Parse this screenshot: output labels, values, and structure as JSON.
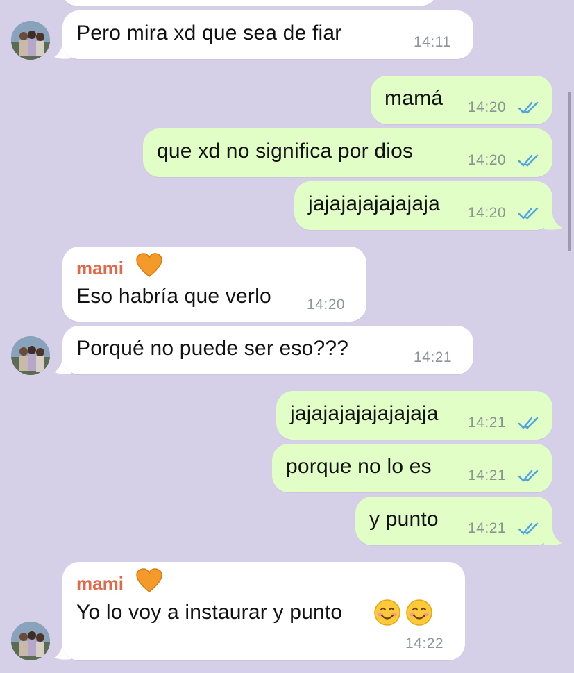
{
  "messages": [
    {
      "text": "Pero mira xd que sea de fiar",
      "time": "14:11"
    },
    {
      "text": "mamá",
      "time": "14:20",
      "status": "read"
    },
    {
      "text": "que xd no significa por dios",
      "time": "14:20",
      "status": "read"
    },
    {
      "text": "jajajajajajajaja",
      "time": "14:20",
      "status": "read"
    },
    {
      "sender": "mami",
      "text": "Eso habría que verlo",
      "time": "14:20"
    },
    {
      "text": "Porqué no puede ser eso???",
      "time": "14:21"
    },
    {
      "text": "jajajajajajajajaja",
      "time": "14:21",
      "status": "read"
    },
    {
      "text": "porque no lo es",
      "time": "14:21",
      "status": "read"
    },
    {
      "text": "y punto",
      "time": "14:21",
      "status": "read"
    },
    {
      "sender": "mami",
      "text": "Yo lo voy a instaurar y punto",
      "emoji": "smiling-face-icon",
      "time": "14:22"
    }
  ],
  "colors": {
    "background": "#d5d0e8",
    "incoming": "#ffffff",
    "outgoing": "#e1fec7",
    "sender_name": "#e2684a",
    "read_ticks": "#4fa3e0"
  },
  "icons": {
    "sender_badge": "orange-heart-icon",
    "read_status": "double-check-icon"
  }
}
